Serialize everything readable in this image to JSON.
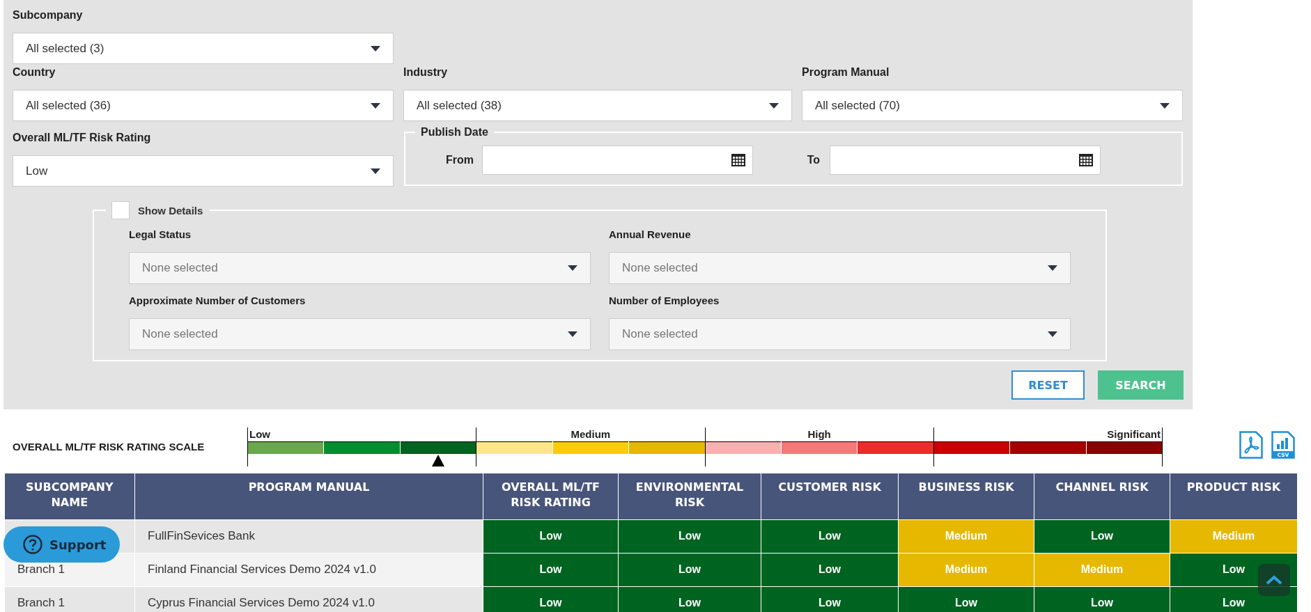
{
  "filter_rows": [
    {
      "fields": [
        {
          "label": "Subcompany",
          "value": "All selected (3)"
        }
      ]
    },
    {
      "fields": [
        {
          "label": "Country",
          "value": "All selected (36)"
        },
        {
          "label": "Industry",
          "value": "All selected (38)"
        },
        {
          "label": "Program Manual",
          "value": "All selected (70)"
        }
      ]
    },
    {
      "fields": [
        {
          "label": "Overall ML/TF Risk Rating",
          "value": "Low"
        }
      ],
      "publish_date": {
        "legend": "Publish Date",
        "from_label": "From",
        "to_label": "To"
      }
    }
  ],
  "details": {
    "legend": "Show Details",
    "checked": false,
    "fields": [
      {
        "label": "Legal Status",
        "value": "None selected",
        "disabled": true
      },
      {
        "label": "Annual Revenue",
        "value": "None selected",
        "disabled": true
      },
      {
        "label": "Approximate Number of Customers",
        "value": "None selected",
        "disabled": true
      },
      {
        "label": "Number of Employees",
        "value": "None selected",
        "disabled": true
      }
    ]
  },
  "buttons": [
    {
      "label": "RESET",
      "kind": "outline"
    },
    {
      "label": "SEARCH",
      "kind": "primary"
    }
  ],
  "scale": {
    "title": "OVERALL ML/TF RISK RATING SCALE",
    "groups": [
      {
        "label": "Low",
        "segments": [
          {
            "color": "#6aa84f",
            "selected": false
          },
          {
            "color": "#008f2e",
            "selected": false
          },
          {
            "color": "#006421",
            "selected": true
          }
        ]
      },
      {
        "label": "Medium",
        "segments": [
          {
            "color": "#fde68a",
            "selected": false
          },
          {
            "color": "#fccc0a",
            "selected": false
          },
          {
            "color": "#e6b800",
            "selected": false
          }
        ]
      },
      {
        "label": "High",
        "segments": [
          {
            "color": "#f8b0b0",
            "selected": false
          },
          {
            "color": "#f47a7a",
            "selected": false
          },
          {
            "color": "#ec2b2b",
            "selected": false
          }
        ]
      },
      {
        "label": "Significant",
        "segments": [
          {
            "color": "#cc0000",
            "selected": false
          },
          {
            "color": "#a40000",
            "selected": false
          },
          {
            "color": "#8b0000",
            "selected": false
          }
        ]
      }
    ]
  },
  "exports": [
    {
      "kind": "pdf"
    },
    {
      "kind": "csv",
      "label": "CSV"
    }
  ],
  "table": {
    "columns": [
      "SUBCOMPANY NAME",
      "PROGRAM MANUAL",
      "OVERALL ML/TF RISK RATING",
      "ENVIRONMENTAL RISK",
      "CUSTOMER RISK",
      "BUSINESS RISK",
      "CHANNEL RISK",
      "PRODUCT RISK"
    ],
    "rows": [
      {
        "manual": "FullFinSevices Bank",
        "ratings": [
          {
            "text": "Low",
            "color": "#006421"
          },
          {
            "text": "Low",
            "color": "#006421"
          },
          {
            "text": "Low",
            "color": "#006421"
          },
          {
            "text": "Medium",
            "color": "#e6b800"
          },
          {
            "text": "Low",
            "color": "#006421"
          },
          {
            "text": "Medium",
            "color": "#e6b800"
          }
        ]
      },
      {
        "name": "Branch 1",
        "manual": "Finland Financial Services Demo 2024 v1.0",
        "ratings": [
          {
            "text": "Low",
            "color": "#006421"
          },
          {
            "text": "Low",
            "color": "#006421"
          },
          {
            "text": "Low",
            "color": "#006421"
          },
          {
            "text": "Medium",
            "color": "#e6b800"
          },
          {
            "text": "Medium",
            "color": "#e6b800"
          },
          {
            "text": "Low",
            "color": "#006421"
          }
        ]
      },
      {
        "name": "Branch 1",
        "manual": "Cyprus Financial Services Demo 2024 v1.0",
        "ratings": [
          {
            "text": "Low",
            "color": "#006421"
          },
          {
            "text": "Low",
            "color": "#006421"
          },
          {
            "text": "Low",
            "color": "#006421"
          },
          {
            "text": "Low",
            "color": "#006421"
          },
          {
            "text": "Low",
            "color": "#006421"
          },
          {
            "text": "Low",
            "color": "#006421"
          }
        ]
      }
    ]
  },
  "support": {
    "label": "Support"
  },
  "back_to_top": true
}
